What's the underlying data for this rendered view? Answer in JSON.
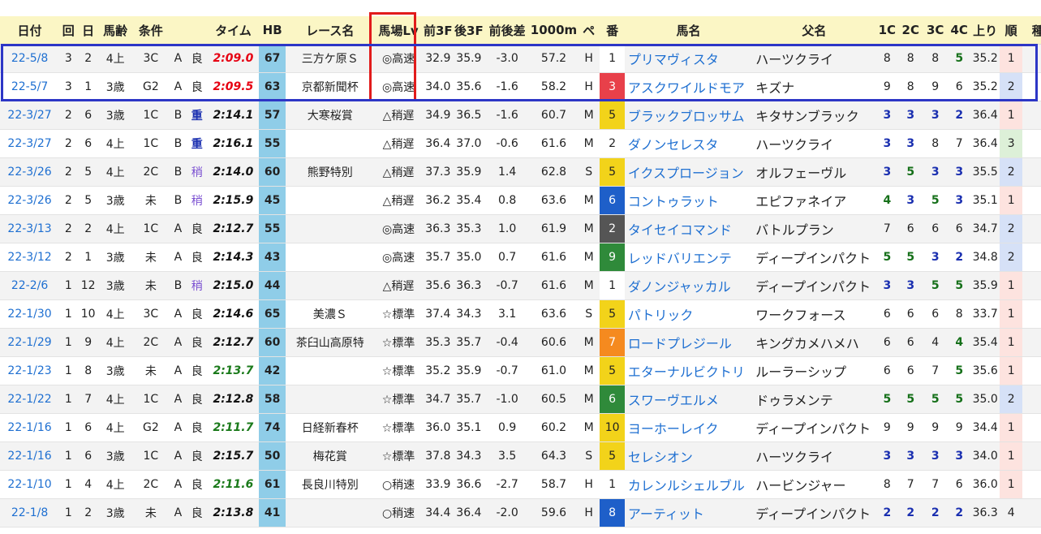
{
  "columns": [
    "日付",
    "回",
    "日",
    "馬齢",
    "条件",
    "",
    "",
    "タイム",
    "HB",
    "レース名",
    "馬場Lv",
    "前3F",
    "後3F",
    "前後差",
    "1000m",
    "ペ",
    "番",
    "馬名",
    "父名",
    "1C",
    "2C",
    "3C",
    "4C",
    "上り",
    "順",
    "種"
  ],
  "rows": [
    {
      "date": "22-5/8",
      "kai": "3",
      "nichi": "2",
      "age": "4上",
      "cond": "3C",
      "course": "A",
      "track": "良",
      "time": "2:09.0",
      "time_color": "red",
      "hb": "67",
      "race": "三方ケ原Ｓ",
      "lv": "◎高速",
      "f3": "32.9",
      "l3": "35.9",
      "diff": "-3.0",
      "t1000": "57.2",
      "pace": "H",
      "ban": "1",
      "ban_color": "white",
      "horse": "プリマヴィスタ",
      "sire": "ハーツクライ",
      "c1": "8",
      "c2": "8",
      "c3": "8",
      "c4": "5",
      "c4_style": "green",
      "agari": "35.2",
      "rank": "1",
      "rank_color": "pink",
      "extra": ""
    },
    {
      "date": "22-5/7",
      "kai": "3",
      "nichi": "1",
      "age": "3歳",
      "cond": "G2",
      "course": "A",
      "track": "良",
      "time": "2:09.5",
      "time_color": "red",
      "hb": "63",
      "race": "京都新聞杯",
      "lv": "◎高速",
      "f3": "34.0",
      "l3": "35.6",
      "diff": "-1.6",
      "t1000": "58.2",
      "pace": "H",
      "ban": "3",
      "ban_color": "red",
      "horse": "アスクワイルドモア",
      "sire": "キズナ",
      "c1": "9",
      "c2": "8",
      "c3": "9",
      "c4": "6",
      "c4_style": "",
      "agari": "35.2",
      "rank": "2",
      "rank_color": "blue",
      "extra": ""
    },
    {
      "date": "22-3/27",
      "kai": "2",
      "nichi": "6",
      "age": "3歳",
      "cond": "1C",
      "course": "B",
      "track": "重",
      "time": "2:14.1",
      "time_color": "black",
      "hb": "57",
      "race": "大寒桜賞",
      "lv": "△稍遅",
      "f3": "34.9",
      "l3": "36.5",
      "diff": "-1.6",
      "t1000": "60.7",
      "pace": "M",
      "ban": "5",
      "ban_color": "yellow",
      "horse": "ブラックブロッサム",
      "sire": "キタサンブラック",
      "c1": "3",
      "c2": "3",
      "c3": "3",
      "c4": "2",
      "c4_style": "navy",
      "agari": "36.4",
      "rank": "1",
      "rank_color": "pink",
      "extra": ""
    },
    {
      "date": "22-3/27",
      "kai": "2",
      "nichi": "6",
      "age": "4上",
      "cond": "1C",
      "course": "B",
      "track": "重",
      "time": "2:16.1",
      "time_color": "black",
      "hb": "55",
      "race": "",
      "lv": "△稍遅",
      "f3": "36.4",
      "l3": "37.0",
      "diff": "-0.6",
      "t1000": "61.6",
      "pace": "M",
      "ban": "2",
      "ban_color": "white",
      "horse": "ダノンセレスタ",
      "sire": "ハーツクライ",
      "c1": "3",
      "c2": "3",
      "c3": "8",
      "c4": "7",
      "c4_style": "",
      "agari": "36.4",
      "rank": "3",
      "rank_color": "green",
      "extra": ""
    },
    {
      "date": "22-3/26",
      "kai": "2",
      "nichi": "5",
      "age": "4上",
      "cond": "2C",
      "course": "B",
      "track": "稍",
      "time": "2:14.0",
      "time_color": "black",
      "hb": "60",
      "race": "熊野特別",
      "lv": "△稍遅",
      "f3": "37.3",
      "l3": "35.9",
      "diff": "1.4",
      "t1000": "62.8",
      "pace": "S",
      "ban": "5",
      "ban_color": "yellow",
      "horse": "イクスプロージョン",
      "sire": "オルフェーヴル",
      "c1": "3",
      "c2": "5",
      "c3": "3",
      "c4": "3",
      "c4_style": "navy",
      "agari": "35.5",
      "rank": "2",
      "rank_color": "blue",
      "extra": ""
    },
    {
      "date": "22-3/26",
      "kai": "2",
      "nichi": "5",
      "age": "3歳",
      "cond": "未",
      "course": "B",
      "track": "稍",
      "time": "2:15.9",
      "time_color": "black",
      "hb": "45",
      "race": "",
      "lv": "△稍遅",
      "f3": "36.2",
      "l3": "35.4",
      "diff": "0.8",
      "t1000": "63.6",
      "pace": "M",
      "ban": "6",
      "ban_color": "blue",
      "horse": "コントゥラット",
      "sire": "エピファネイア",
      "c1": "4",
      "c2": "3",
      "c3": "5",
      "c4": "3",
      "c4_style": "navy",
      "agari": "35.1",
      "rank": "1",
      "rank_color": "pink",
      "extra": ""
    },
    {
      "date": "22-3/13",
      "kai": "2",
      "nichi": "2",
      "age": "4上",
      "cond": "1C",
      "course": "A",
      "track": "良",
      "time": "2:12.7",
      "time_color": "black",
      "hb": "55",
      "race": "",
      "lv": "◎高速",
      "f3": "36.3",
      "l3": "35.3",
      "diff": "1.0",
      "t1000": "61.9",
      "pace": "M",
      "ban": "2",
      "ban_color": "gray",
      "horse": "タイセイコマンド",
      "sire": "バトルプラン",
      "c1": "7",
      "c2": "6",
      "c3": "6",
      "c4": "6",
      "c4_style": "",
      "agari": "34.7",
      "rank": "2",
      "rank_color": "blue",
      "extra": ""
    },
    {
      "date": "22-3/12",
      "kai": "2",
      "nichi": "1",
      "age": "3歳",
      "cond": "未",
      "course": "A",
      "track": "良",
      "time": "2:14.3",
      "time_color": "black",
      "hb": "43",
      "race": "",
      "lv": "◎高速",
      "f3": "35.7",
      "l3": "35.0",
      "diff": "0.7",
      "t1000": "61.6",
      "pace": "M",
      "ban": "9",
      "ban_color": "green",
      "horse": "レッドバリエンテ",
      "sire": "ディープインパクト",
      "c1": "5",
      "c2": "5",
      "c3": "3",
      "c4": "2",
      "c4_style": "navy",
      "agari": "34.8",
      "rank": "2",
      "rank_color": "blue",
      "extra": ""
    },
    {
      "date": "22-2/6",
      "kai": "1",
      "nichi": "12",
      "age": "3歳",
      "cond": "未",
      "course": "B",
      "track": "稍",
      "time": "2:15.0",
      "time_color": "black",
      "hb": "44",
      "race": "",
      "lv": "△稍遅",
      "f3": "35.6",
      "l3": "36.3",
      "diff": "-0.7",
      "t1000": "61.6",
      "pace": "M",
      "ban": "1",
      "ban_color": "white",
      "horse": "ダノンジャッカル",
      "sire": "ディープインパクト",
      "c1": "3",
      "c2": "3",
      "c3": "5",
      "c4": "5",
      "c4_style": "green",
      "agari": "35.9",
      "rank": "1",
      "rank_color": "pink",
      "extra": ""
    },
    {
      "date": "22-1/30",
      "kai": "1",
      "nichi": "10",
      "age": "4上",
      "cond": "3C",
      "course": "A",
      "track": "良",
      "time": "2:14.6",
      "time_color": "black",
      "hb": "65",
      "race": "美濃Ｓ",
      "lv": "☆標準",
      "f3": "37.4",
      "l3": "34.3",
      "diff": "3.1",
      "t1000": "63.6",
      "pace": "S",
      "ban": "5",
      "ban_color": "yellow",
      "horse": "パトリック",
      "sire": "ワークフォース",
      "c1": "6",
      "c2": "6",
      "c3": "6",
      "c4": "8",
      "c4_style": "",
      "agari": "33.7",
      "rank": "1",
      "rank_color": "pink",
      "extra": ""
    },
    {
      "date": "22-1/29",
      "kai": "1",
      "nichi": "9",
      "age": "4上",
      "cond": "2C",
      "course": "A",
      "track": "良",
      "time": "2:12.7",
      "time_color": "black",
      "hb": "60",
      "race": "茶臼山高原特",
      "lv": "☆標準",
      "f3": "35.3",
      "l3": "35.7",
      "diff": "-0.4",
      "t1000": "60.6",
      "pace": "M",
      "ban": "7",
      "ban_color": "orange",
      "horse": "ロードプレジール",
      "sire": "キングカメハメハ",
      "c1": "6",
      "c2": "6",
      "c3": "4",
      "c4": "4",
      "c4_style": "green",
      "agari": "35.4",
      "rank": "1",
      "rank_color": "pink",
      "extra": ""
    },
    {
      "date": "22-1/23",
      "kai": "1",
      "nichi": "8",
      "age": "3歳",
      "cond": "未",
      "course": "A",
      "track": "良",
      "time": "2:13.7",
      "time_color": "green",
      "hb": "42",
      "race": "",
      "lv": "☆標準",
      "f3": "35.2",
      "l3": "35.9",
      "diff": "-0.7",
      "t1000": "61.0",
      "pace": "M",
      "ban": "5",
      "ban_color": "yellow",
      "horse": "エターナルビクトリ",
      "sire": "ルーラーシップ",
      "c1": "6",
      "c2": "6",
      "c3": "7",
      "c4": "5",
      "c4_style": "green",
      "agari": "35.6",
      "rank": "1",
      "rank_color": "pink",
      "extra": ""
    },
    {
      "date": "22-1/22",
      "kai": "1",
      "nichi": "7",
      "age": "4上",
      "cond": "1C",
      "course": "A",
      "track": "良",
      "time": "2:12.8",
      "time_color": "black",
      "hb": "58",
      "race": "",
      "lv": "☆標準",
      "f3": "34.7",
      "l3": "35.7",
      "diff": "-1.0",
      "t1000": "60.5",
      "pace": "M",
      "ban": "6",
      "ban_color": "green",
      "horse": "スワーヴエルメ",
      "sire": "ドゥラメンテ",
      "c1": "5",
      "c2": "5",
      "c3": "5",
      "c4": "5",
      "c4_style": "green",
      "agari": "35.0",
      "rank": "2",
      "rank_color": "blue",
      "extra": ""
    },
    {
      "date": "22-1/16",
      "kai": "1",
      "nichi": "6",
      "age": "4上",
      "cond": "G2",
      "course": "A",
      "track": "良",
      "time": "2:11.7",
      "time_color": "green",
      "hb": "74",
      "race": "日経新春杯",
      "lv": "☆標準",
      "f3": "36.0",
      "l3": "35.1",
      "diff": "0.9",
      "t1000": "60.2",
      "pace": "M",
      "ban": "10",
      "ban_color": "yellow",
      "horse": "ヨーホーレイク",
      "sire": "ディープインパクト",
      "c1": "9",
      "c2": "9",
      "c3": "9",
      "c4": "9",
      "c4_style": "",
      "agari": "34.4",
      "rank": "1",
      "rank_color": "pink",
      "extra": ""
    },
    {
      "date": "22-1/16",
      "kai": "1",
      "nichi": "6",
      "age": "3歳",
      "cond": "1C",
      "course": "A",
      "track": "良",
      "time": "2:15.7",
      "time_color": "black",
      "hb": "50",
      "race": "梅花賞",
      "lv": "☆標準",
      "f3": "37.8",
      "l3": "34.3",
      "diff": "3.5",
      "t1000": "64.3",
      "pace": "S",
      "ban": "5",
      "ban_color": "yellow",
      "horse": "セレシオン",
      "sire": "ハーツクライ",
      "c1": "3",
      "c2": "3",
      "c3": "3",
      "c4": "3",
      "c4_style": "navy",
      "agari": "34.0",
      "rank": "1",
      "rank_color": "pink",
      "extra": ""
    },
    {
      "date": "22-1/10",
      "kai": "1",
      "nichi": "4",
      "age": "4上",
      "cond": "2C",
      "course": "A",
      "track": "良",
      "time": "2:11.6",
      "time_color": "green",
      "hb": "61",
      "race": "長良川特別",
      "lv": "○稍速",
      "f3": "33.9",
      "l3": "36.6",
      "diff": "-2.7",
      "t1000": "58.7",
      "pace": "H",
      "ban": "1",
      "ban_color": "white",
      "horse": "カレンルシェルブル",
      "sire": "ハービンジャー",
      "c1": "8",
      "c2": "7",
      "c3": "7",
      "c4": "6",
      "c4_style": "",
      "agari": "36.0",
      "rank": "1",
      "rank_color": "pink",
      "extra": ""
    },
    {
      "date": "22-1/8",
      "kai": "1",
      "nichi": "2",
      "age": "3歳",
      "cond": "未",
      "course": "A",
      "track": "良",
      "time": "2:13.8",
      "time_color": "black",
      "hb": "41",
      "race": "",
      "lv": "○稍速",
      "f3": "34.4",
      "l3": "36.4",
      "diff": "-2.0",
      "t1000": "59.6",
      "pace": "H",
      "ban": "8",
      "ban_color": "blue",
      "horse": "アーティット",
      "sire": "ディープインパクト",
      "c1": "2",
      "c2": "2",
      "c3": "2",
      "c4": "2",
      "c4_style": "navy",
      "agari": "36.3",
      "rank": "4",
      "rank_color": "none",
      "extra": ""
    }
  ]
}
